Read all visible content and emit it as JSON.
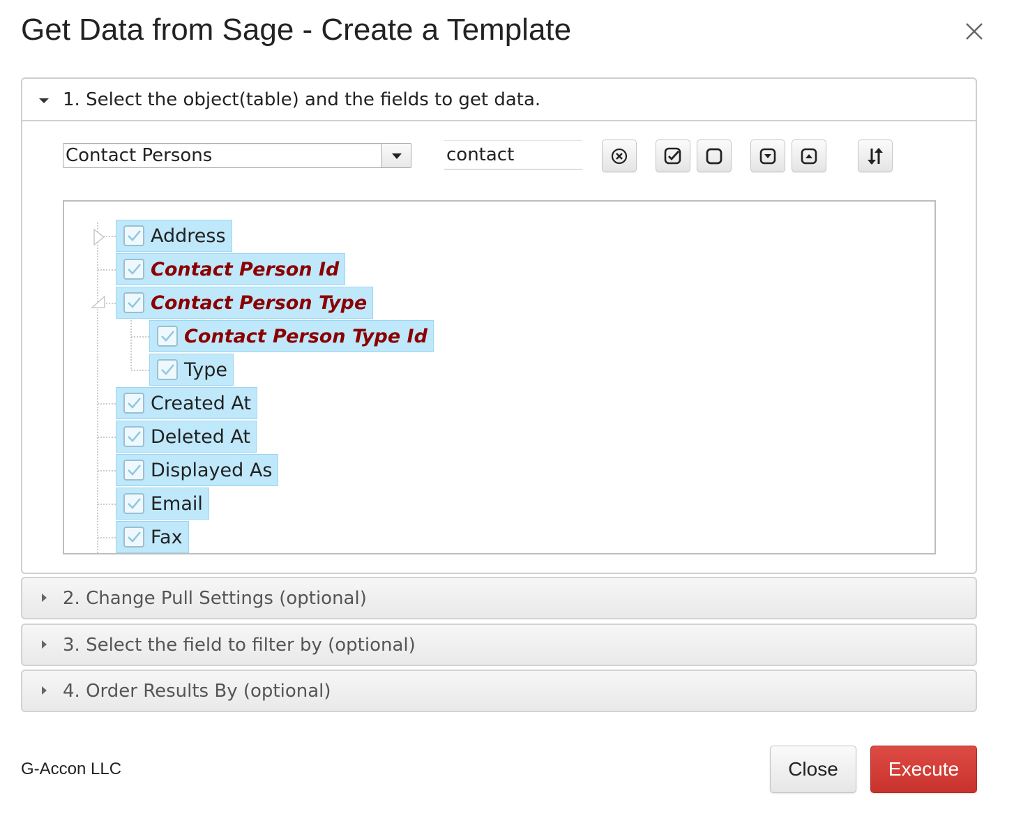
{
  "dialog": {
    "title": "Get Data from Sage - Create a Template",
    "close_icon": "close-icon"
  },
  "section1": {
    "label": "1. Select the object(table) and the fields to get data.",
    "object_select_value": "Contact Persons",
    "search_value": "contact",
    "toolbar_icons": [
      "clear-search-icon",
      "check-all-icon",
      "uncheck-all-icon",
      "expand-all-icon",
      "collapse-all-icon",
      "sort-icon"
    ]
  },
  "tree": {
    "nodes": [
      {
        "label": "Address",
        "checked": true,
        "key": false,
        "expander": "collapsed"
      },
      {
        "label": "Contact Person Id",
        "checked": true,
        "key": true
      },
      {
        "label": "Contact Person Type",
        "checked": true,
        "key": true,
        "expander": "expanded"
      },
      {
        "label": "Contact Person Type Id",
        "checked": true,
        "key": true
      },
      {
        "label": "Type",
        "checked": true,
        "key": false
      },
      {
        "label": "Created At",
        "checked": true,
        "key": false
      },
      {
        "label": "Deleted At",
        "checked": true,
        "key": false
      },
      {
        "label": "Displayed As",
        "checked": true,
        "key": false
      },
      {
        "label": "Email",
        "checked": true,
        "key": false
      },
      {
        "label": "Fax",
        "checked": true,
        "key": false
      }
    ]
  },
  "sections": [
    {
      "label": "2. Change Pull Settings (optional)"
    },
    {
      "label": "3. Select the field to filter by (optional)"
    },
    {
      "label": "4. Order Results By (optional)"
    }
  ],
  "footer": {
    "company": "G-Accon LLC",
    "close_label": "Close",
    "execute_label": "Execute"
  },
  "colors": {
    "node_bg": "#bfe8fb",
    "key_field_text": "#8b0000",
    "execute_bg": "#d0382f"
  }
}
